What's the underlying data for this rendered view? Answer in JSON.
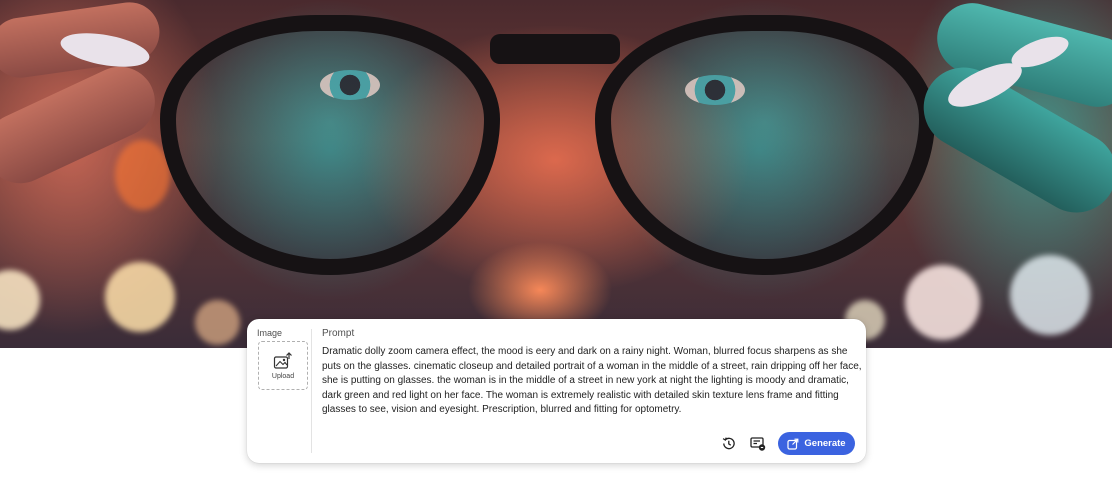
{
  "hero": {
    "alt_subject": ""
  },
  "image_panel": {
    "label": "Image",
    "upload_label": "Upload"
  },
  "prompt": {
    "label": "Prompt",
    "text": "Dramatic dolly zoom camera effect, the mood is eery and dark on a rainy night. Woman, blurred focus sharpens as she puts on the glasses. cinematic closeup and detailed portrait of a woman in the middle of a street, rain dripping off her face, she is putting on glasses. the woman is in the middle of a street in new york at night the lighting is moody and dramatic, dark green and red light on her face. The woman is extremely realistic with detailed skin texture lens frame and fitting glasses to see, vision and eyesight. Prescription, blurred and fitting for optometry."
  },
  "actions": {
    "history_icon": "history-icon",
    "credits_icon": "credits-icon",
    "generate_label": "Generate"
  },
  "colors": {
    "accent": "#3b63e0"
  }
}
